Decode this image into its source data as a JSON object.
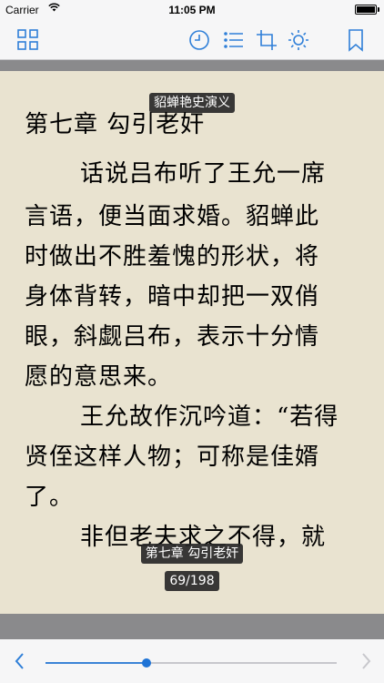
{
  "status_bar": {
    "carrier": "Carrier",
    "time": "11:05 PM",
    "battery_level": 1.0
  },
  "toolbar": {
    "accent_color": "#2f7fd8",
    "left_icon": "grid-icon",
    "right_icons": [
      "clock-icon",
      "list-icon",
      "crop-icon",
      "brightness-icon",
      "bookmark-icon"
    ]
  },
  "page": {
    "book_title": "貂蝉艳史演义",
    "chapter_heading": "第七章 勾引老奸",
    "lines": [
      "话说吕布听了王允一席",
      "言语，便当面求婚。貂蝉此",
      "时做出不胜羞愧的形状，将",
      "身体背转，暗中却把一双俏",
      "眼，斜觑吕布，表示十分情",
      "愿的意思来。",
      "王允故作沉吟道：“若得",
      "贤侄这样人物；可称是佳婿",
      "了。",
      "非但老夫求之不得，就"
    ],
    "footer_chapter": "第七章 勾引老奸",
    "footer_page": "69/198",
    "background_color": "#e9e3d0"
  },
  "reading_progress": {
    "current_page": 69,
    "total_pages": 198,
    "fraction": 0.348
  }
}
